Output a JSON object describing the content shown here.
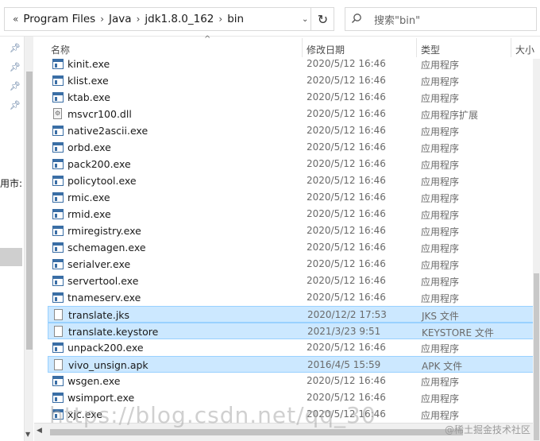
{
  "address": {
    "prefix": "«",
    "crumbs": [
      "Program Files",
      "Java",
      "jdk1.8.0_162",
      "bin"
    ],
    "separator": "›"
  },
  "refresh_glyph": "↻",
  "search": {
    "placeholder": "搜索\"bin\""
  },
  "nav": {
    "cut_label": "用市:"
  },
  "columns": {
    "name": "名称",
    "date": "修改日期",
    "type": "类型",
    "size": "大小"
  },
  "files": [
    {
      "name": "kinit.exe",
      "date": "2020/5/12 16:46",
      "type": "应用程序",
      "icon": "exe-icon",
      "selected": false
    },
    {
      "name": "klist.exe",
      "date": "2020/5/12 16:46",
      "type": "应用程序",
      "icon": "exe-icon",
      "selected": false
    },
    {
      "name": "ktab.exe",
      "date": "2020/5/12 16:46",
      "type": "应用程序",
      "icon": "exe-icon",
      "selected": false
    },
    {
      "name": "msvcr100.dll",
      "date": "2020/5/12 16:46",
      "type": "应用程序扩展",
      "icon": "dll-icon",
      "selected": false
    },
    {
      "name": "native2ascii.exe",
      "date": "2020/5/12 16:46",
      "type": "应用程序",
      "icon": "exe-icon",
      "selected": false
    },
    {
      "name": "orbd.exe",
      "date": "2020/5/12 16:46",
      "type": "应用程序",
      "icon": "exe-icon",
      "selected": false
    },
    {
      "name": "pack200.exe",
      "date": "2020/5/12 16:46",
      "type": "应用程序",
      "icon": "exe-icon",
      "selected": false
    },
    {
      "name": "policytool.exe",
      "date": "2020/5/12 16:46",
      "type": "应用程序",
      "icon": "exe-icon",
      "selected": false
    },
    {
      "name": "rmic.exe",
      "date": "2020/5/12 16:46",
      "type": "应用程序",
      "icon": "exe-icon",
      "selected": false
    },
    {
      "name": "rmid.exe",
      "date": "2020/5/12 16:46",
      "type": "应用程序",
      "icon": "exe-icon",
      "selected": false
    },
    {
      "name": "rmiregistry.exe",
      "date": "2020/5/12 16:46",
      "type": "应用程序",
      "icon": "exe-icon",
      "selected": false
    },
    {
      "name": "schemagen.exe",
      "date": "2020/5/12 16:46",
      "type": "应用程序",
      "icon": "exe-icon",
      "selected": false
    },
    {
      "name": "serialver.exe",
      "date": "2020/5/12 16:46",
      "type": "应用程序",
      "icon": "exe-icon",
      "selected": false
    },
    {
      "name": "servertool.exe",
      "date": "2020/5/12 16:46",
      "type": "应用程序",
      "icon": "exe-icon",
      "selected": false
    },
    {
      "name": "tnameserv.exe",
      "date": "2020/5/12 16:46",
      "type": "应用程序",
      "icon": "exe-icon",
      "selected": false
    },
    {
      "name": "translate.jks",
      "date": "2020/12/2 17:53",
      "type": "JKS 文件",
      "icon": "document-icon",
      "selected": true
    },
    {
      "name": "translate.keystore",
      "date": "2021/3/23 9:51",
      "type": "KEYSTORE 文件",
      "icon": "document-icon",
      "selected": true
    },
    {
      "name": "unpack200.exe",
      "date": "2020/5/12 16:46",
      "type": "应用程序",
      "icon": "exe-icon",
      "selected": false
    },
    {
      "name": "vivo_unsign.apk",
      "date": "2016/4/5 15:59",
      "type": "APK 文件",
      "icon": "document-icon",
      "selected": true
    },
    {
      "name": "wsgen.exe",
      "date": "2020/5/12 16:46",
      "type": "应用程序",
      "icon": "exe-icon",
      "selected": false
    },
    {
      "name": "wsimport.exe",
      "date": "2020/5/12 16:46",
      "type": "应用程序",
      "icon": "exe-icon",
      "selected": false
    },
    {
      "name": "xjc.exe",
      "date": "2020/5/12 16:46",
      "type": "应用程序",
      "icon": "exe-icon",
      "selected": false
    }
  ],
  "watermark": "https://blog.csdn.net/qq_30",
  "watermark_corner": "@稀土掘金技术社区"
}
